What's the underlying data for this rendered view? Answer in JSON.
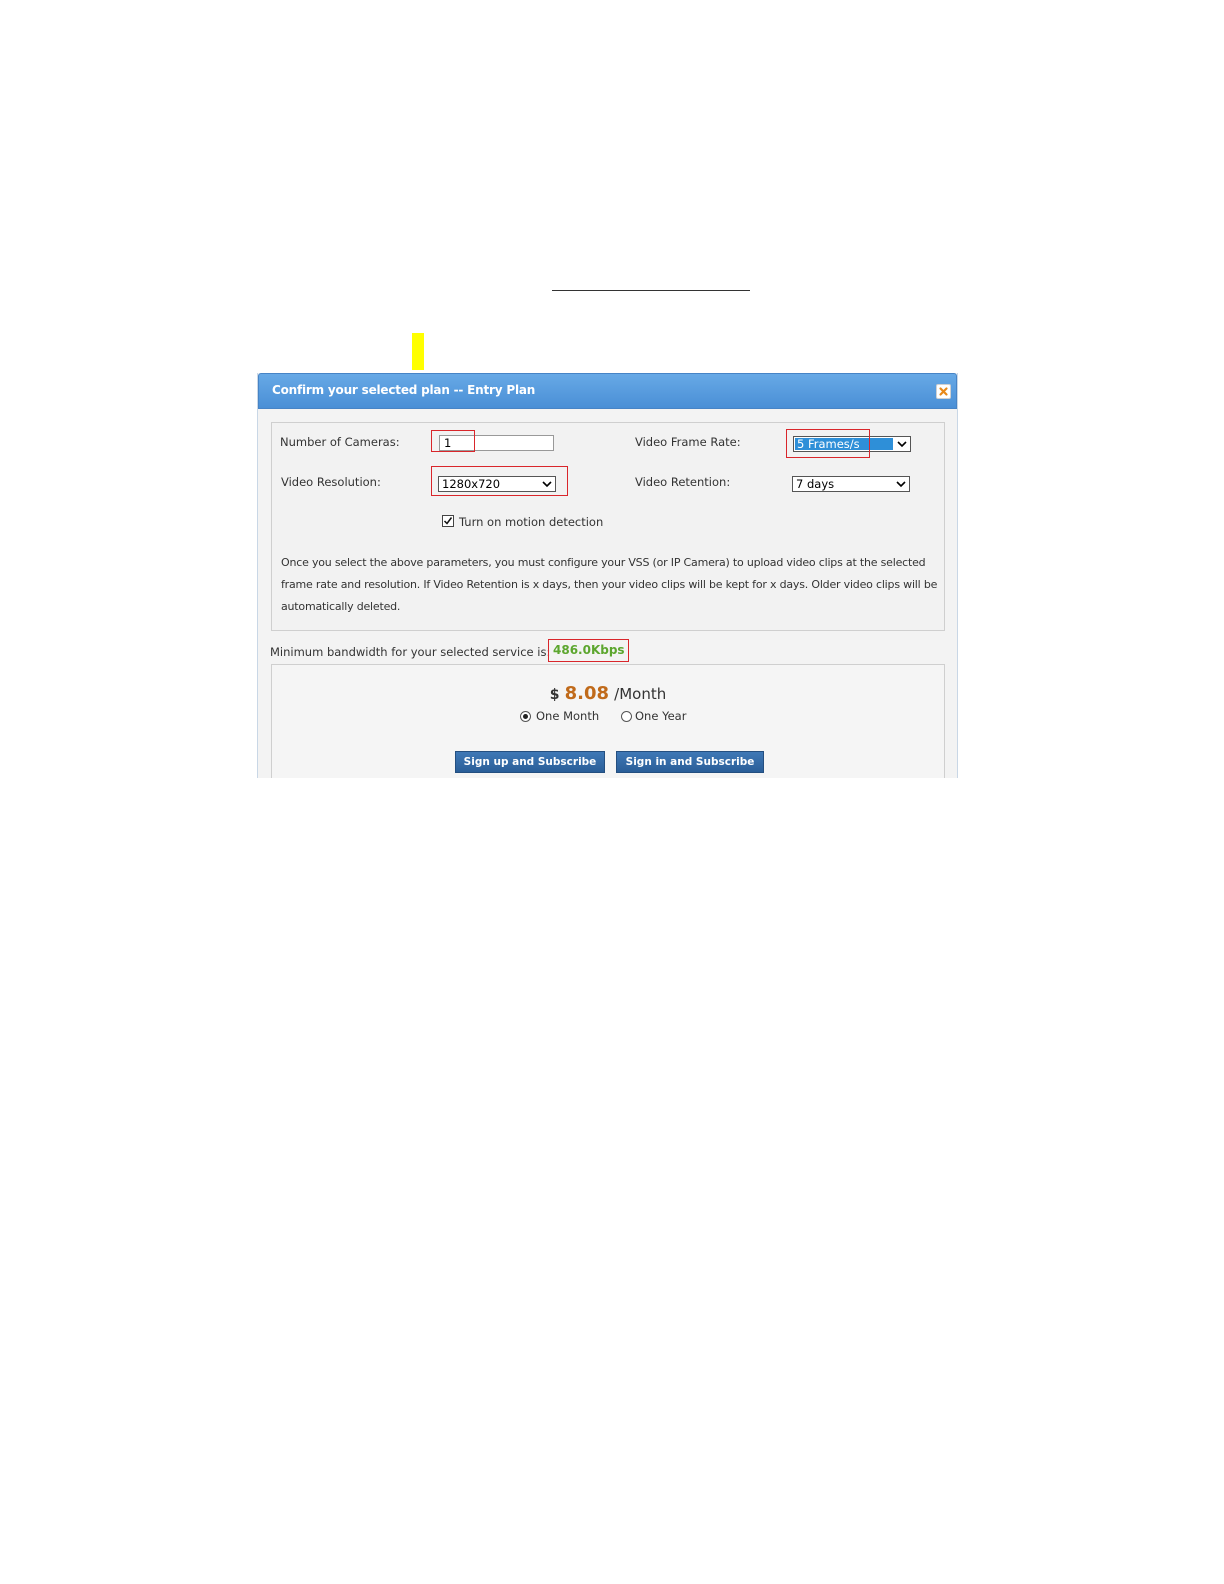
{
  "dialog": {
    "title": "Confirm your selected plan -- Entry Plan",
    "close_icon": "close-icon"
  },
  "form": {
    "cameras_label": "Number of Cameras:",
    "cameras_value": "1",
    "frame_rate_label": "Video Frame Rate:",
    "frame_rate_value": "5 Frames/s",
    "resolution_label": "Video Resolution:",
    "resolution_value": "1280x720",
    "retention_label": "Video Retention:",
    "retention_value": "7 days",
    "motion_label": "Turn on motion detection",
    "motion_checked": true,
    "description": "Once you select the above parameters, you must configure your VSS (or IP Camera) to upload video clips at the selected frame rate and resolution. If Video Retention is x days, then your video clips will be kept for x days. Older video clips will be automatically deleted."
  },
  "bandwidth": {
    "label": "Minimum bandwidth for your selected service is:",
    "value": "486.0Kbps"
  },
  "pricing": {
    "currency": "$",
    "amount": "8.08",
    "period": "/Month",
    "option_month": "One Month",
    "option_year": "One Year",
    "selected": "month",
    "signup_button": "Sign up and Subscribe",
    "signin_button": "Sign in and Subscribe"
  },
  "colors": {
    "title_bar": "#4a8fd6",
    "annotation_red": "#d9262b",
    "highlight_yellow": "#ffff00",
    "bandwidth_green": "#5ca62e",
    "price_orange": "#c06a1a",
    "button_blue": "#2a5e98"
  }
}
